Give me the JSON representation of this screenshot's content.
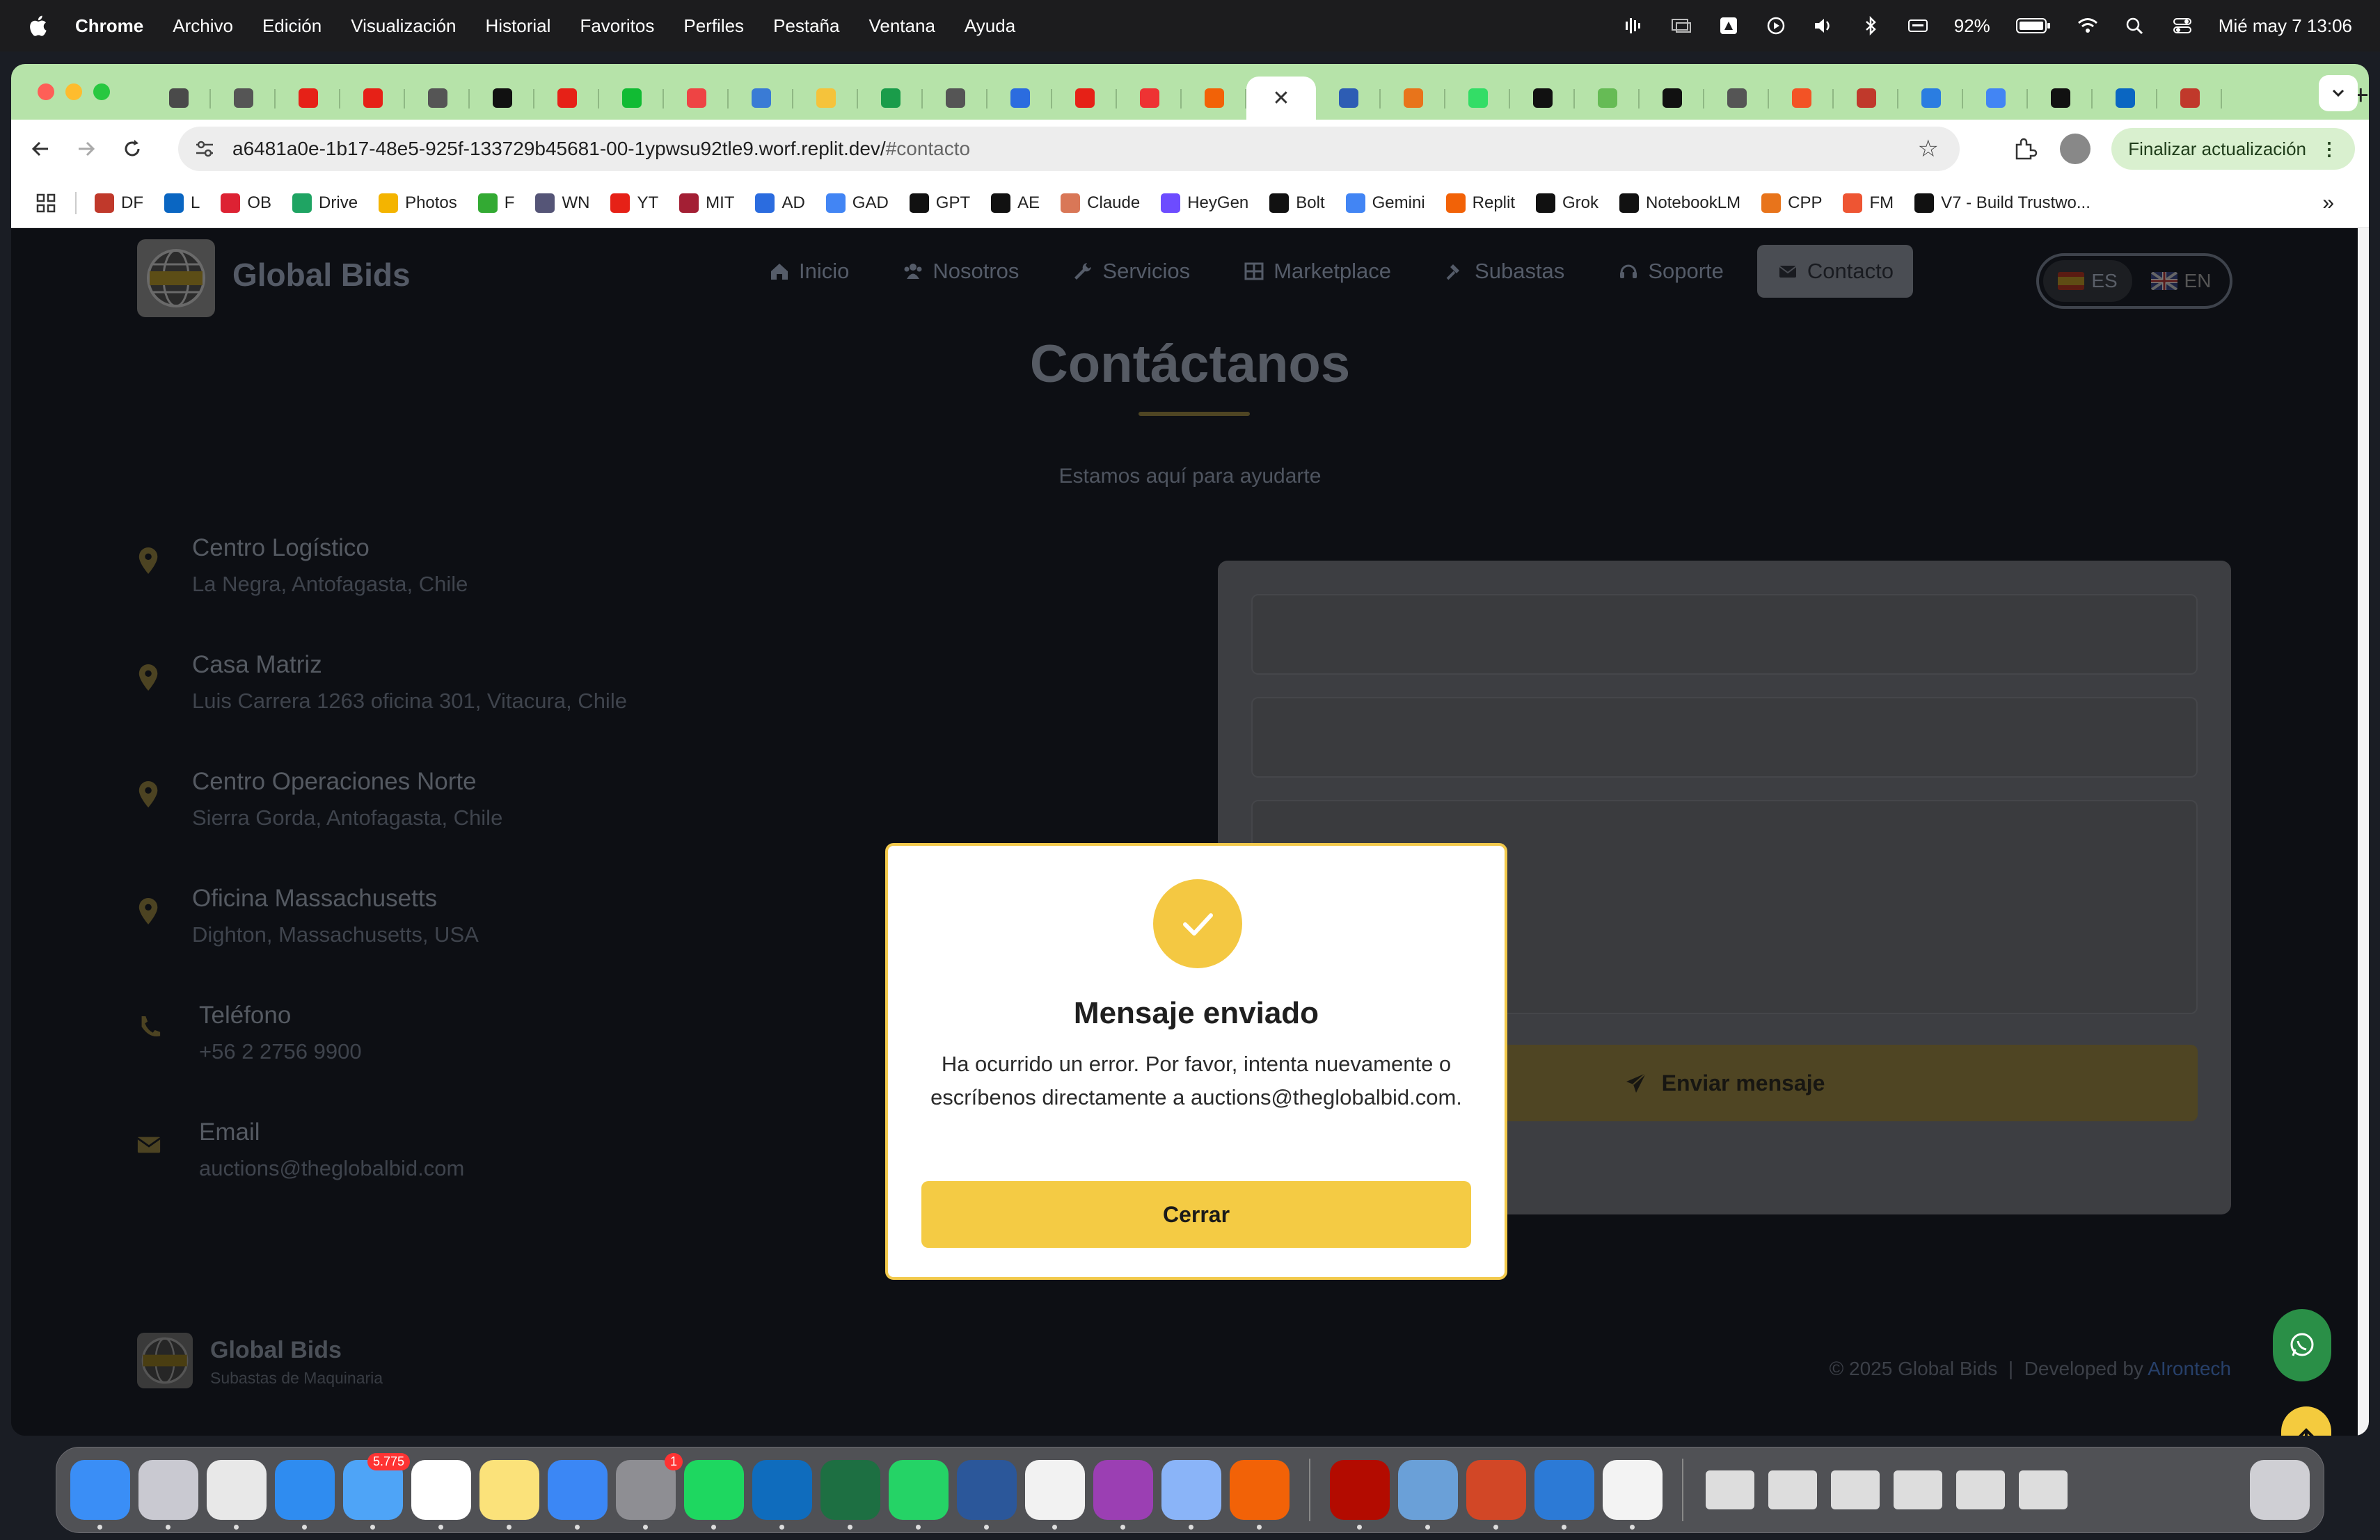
{
  "menubar": {
    "app_name": "Chrome",
    "items": [
      "Archivo",
      "Edición",
      "Visualización",
      "Historial",
      "Favoritos",
      "Perfiles",
      "Pestaña",
      "Ventana",
      "Ayuda"
    ],
    "battery": "92%",
    "datetime": "Mié may 7  13:06"
  },
  "browser": {
    "tabs": [
      {
        "icon": "chrome-icon",
        "color": "#4a4a4a"
      },
      {
        "icon": "cursor-icon",
        "color": "#555"
      },
      {
        "icon": "youtube-icon",
        "color": "#e62117"
      },
      {
        "icon": "youtube-icon",
        "color": "#e62117"
      },
      {
        "icon": "globe-icon",
        "color": "#555"
      },
      {
        "icon": "u-icon",
        "color": "#111"
      },
      {
        "icon": "youtube-icon",
        "color": "#e62117"
      },
      {
        "icon": "v-icon",
        "color": "#1b3"
      },
      {
        "icon": "red-logo-icon",
        "color": "#e44"
      },
      {
        "icon": "cloud-icon",
        "color": "#3a7bd5"
      },
      {
        "icon": "hugging-face-icon",
        "color": "#f5c33b"
      },
      {
        "icon": "sheets-icon",
        "color": "#1a9c4a"
      },
      {
        "icon": "cursor-icon",
        "color": "#555"
      },
      {
        "icon": "c-icon",
        "color": "#2b6cdf"
      },
      {
        "icon": "youtube-icon",
        "color": "#e62117"
      },
      {
        "icon": "l-icon",
        "color": "#e33"
      },
      {
        "icon": "replit-icon",
        "color": "#f26207"
      },
      {
        "icon": "close-icon",
        "active": true
      },
      {
        "icon": "shield-icon",
        "color": "#2d5db4"
      },
      {
        "icon": "cp-icon",
        "color": "#e8741b"
      },
      {
        "icon": "cube-icon",
        "color": "#3d6"
      },
      {
        "icon": "openai-icon",
        "color": "#111"
      },
      {
        "icon": "copilot-icon",
        "color": "#6b5"
      },
      {
        "icon": "notion-icon",
        "color": "#111"
      },
      {
        "icon": "globe-icon",
        "color": "#555"
      },
      {
        "icon": "microsoft-icon",
        "color": "#f35325"
      },
      {
        "icon": "df-icon",
        "color": "#c0392b"
      },
      {
        "icon": "bing-icon",
        "color": "#2a7de1"
      },
      {
        "icon": "google-icon",
        "color": "#4285f4"
      },
      {
        "icon": "b-icon",
        "color": "#111"
      },
      {
        "icon": "linkedin-icon",
        "color": "#0a66c2"
      },
      {
        "icon": "df-icon",
        "color": "#c0392b"
      }
    ],
    "url_host": "a6481a0e-1b17-48e5-925f-133729b45681-00-1ypwsu92tle9.worf.replit.dev/",
    "url_hash": "#contacto",
    "update_label": "Finalizar actualización",
    "bookmarks": [
      {
        "label": "DF",
        "color": "#c0392b"
      },
      {
        "label": "L",
        "color": "#0a66c2"
      },
      {
        "label": "OB",
        "color": "#d23"
      },
      {
        "label": "Drive",
        "color": "#1fa463"
      },
      {
        "label": "Photos",
        "color": "#f4b400"
      },
      {
        "label": "F",
        "color": "#3a3"
      },
      {
        "label": "WN",
        "color": "#557"
      },
      {
        "label": "YT",
        "color": "#e62117"
      },
      {
        "label": "MIT",
        "color": "#a31f34"
      },
      {
        "label": "AD",
        "color": "#2b6cdf"
      },
      {
        "label": "GAD",
        "color": "#4285f4"
      },
      {
        "label": "GPT",
        "color": "#111"
      },
      {
        "label": "AE",
        "color": "#111"
      },
      {
        "label": "Claude",
        "color": "#d97757"
      },
      {
        "label": "HeyGen",
        "color": "#6d4cff"
      },
      {
        "label": "Bolt",
        "color": "#111"
      },
      {
        "label": "Gemini",
        "color": "#4285f4"
      },
      {
        "label": "Replit",
        "color": "#f26207"
      },
      {
        "label": "Grok",
        "color": "#111"
      },
      {
        "label": "NotebookLM",
        "color": "#111"
      },
      {
        "label": "CPP",
        "color": "#e8741b"
      },
      {
        "label": "FM",
        "color": "#e53"
      },
      {
        "label": "V7 - Build Trustwo...",
        "color": "#111"
      }
    ]
  },
  "site": {
    "brand": "Global Bids",
    "nav": [
      {
        "label": "Inicio",
        "icon": "home-icon"
      },
      {
        "label": "Nosotros",
        "icon": "users-icon"
      },
      {
        "label": "Servicios",
        "icon": "wrench-icon"
      },
      {
        "label": "Marketplace",
        "icon": "grid-icon"
      },
      {
        "label": "Subastas",
        "icon": "gavel-icon"
      },
      {
        "label": "Soporte",
        "icon": "headset-icon"
      },
      {
        "label": "Contacto",
        "icon": "envelope-icon",
        "active": true
      }
    ],
    "lang_es": "ES",
    "lang_en": "EN",
    "title": "Contáctanos",
    "subtitle": "Estamos aquí para ayudarte",
    "locations": [
      {
        "label": "Centro Logístico",
        "value": "La Negra, Antofagasta, Chile",
        "icon": "map-pin-icon"
      },
      {
        "label": "Casa Matriz",
        "value": "Luis Carrera 1263 oficina 301, Vitacura, Chile",
        "icon": "map-pin-icon"
      },
      {
        "label": "Centro Operaciones Norte",
        "value": "Sierra Gorda, Antofagasta, Chile",
        "icon": "map-pin-icon"
      },
      {
        "label": "Oficina Massachusetts",
        "value": "Dighton, Massachusetts, USA",
        "icon": "map-pin-icon"
      },
      {
        "label": "Teléfono",
        "value": "+56 2 2756 9900",
        "icon": "phone-icon"
      },
      {
        "label": "Email",
        "value": "auctions@theglobalbid.com",
        "icon": "envelope-icon"
      }
    ],
    "send_label": "Enviar mensaje",
    "footer_brand": "Global Bids",
    "footer_tagline": "Subastas de Maquinaria",
    "footer_copy": "© 2025 Global Bids  |  Developed by ",
    "footer_dev": "AIrontech",
    "accent": "#f4cb44"
  },
  "modal": {
    "title": "Mensaje enviado",
    "body": "Ha ocurrido un error. Por favor, intenta nuevamente o escríbenos directamente a auctions@theglobalbid.com.",
    "button": "Cerrar"
  },
  "dock": {
    "apps": [
      {
        "name": "finder-icon",
        "color": "#3a8ef6"
      },
      {
        "name": "launchpad-icon",
        "color": "#c9c9d1"
      },
      {
        "name": "chrome-icon",
        "color": "#e8e8e8"
      },
      {
        "name": "safari-icon",
        "color": "#2f8cf0"
      },
      {
        "name": "mail-icon",
        "color": "#4ea4f7",
        "badge": "5.775"
      },
      {
        "name": "calendar-icon",
        "color": "#ffffff"
      },
      {
        "name": "notes-icon",
        "color": "#fbe27a"
      },
      {
        "name": "keynote-icon",
        "color": "#3b87f5"
      },
      {
        "name": "system-settings-icon",
        "color": "#8e8e93",
        "badge": "1"
      },
      {
        "name": "spotify-icon",
        "color": "#1ed760"
      },
      {
        "name": "outlook-icon",
        "color": "#0f6cbd"
      },
      {
        "name": "excel-icon",
        "color": "#1d6f42"
      },
      {
        "name": "whatsapp-icon",
        "color": "#25d366"
      },
      {
        "name": "word-icon",
        "color": "#2b579a"
      },
      {
        "name": "calendar-7-icon",
        "color": "#f2f2f2"
      },
      {
        "name": "circle-app-icon",
        "color": "#9b3fb3"
      },
      {
        "name": "iphone-mirroring-icon",
        "color": "#8ab4f8"
      },
      {
        "name": "replit-icon",
        "color": "#f26207"
      }
    ],
    "apps2": [
      {
        "name": "acrobat-icon",
        "color": "#b30b00"
      },
      {
        "name": "preview-icon",
        "color": "#6aa0d8"
      },
      {
        "name": "powerpoint-icon",
        "color": "#d24726"
      },
      {
        "name": "vscode-icon",
        "color": "#2c7ad6"
      },
      {
        "name": "textedit-icon",
        "color": "#f3f3f3"
      }
    ]
  }
}
